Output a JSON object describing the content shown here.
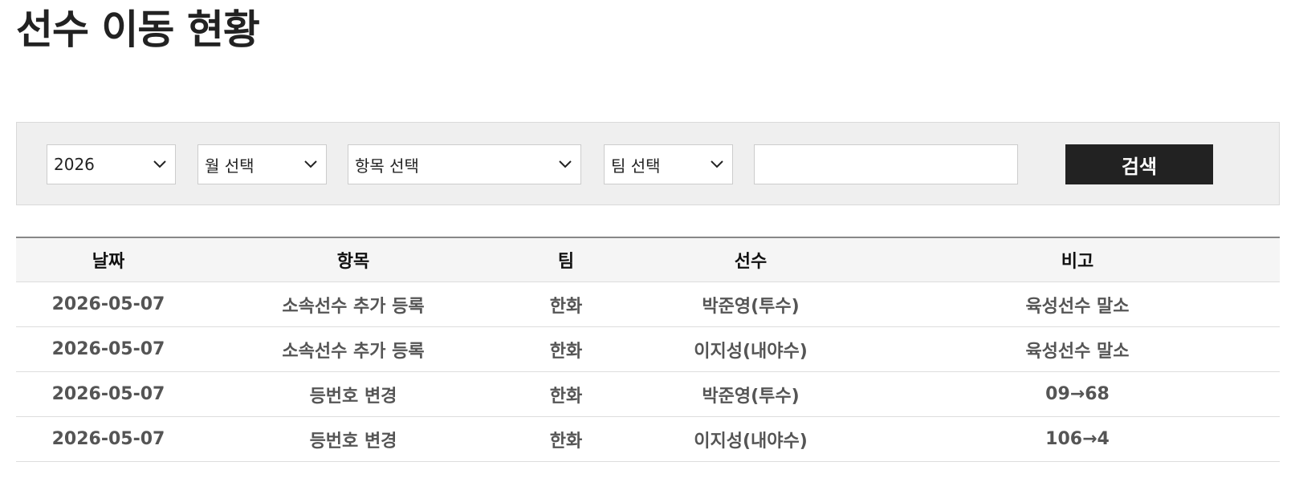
{
  "page": {
    "title": "선수 이동 현황"
  },
  "filters": {
    "year": {
      "selected": "2026"
    },
    "month": {
      "selected": "월 선택"
    },
    "item": {
      "selected": "항목 선택"
    },
    "team": {
      "selected": "팀 선택"
    },
    "search_input": {
      "value": "",
      "placeholder": ""
    },
    "search_button_label": "검색"
  },
  "icons": {
    "dropdown": "chevron-down-icon"
  },
  "table": {
    "headers": [
      "날짜",
      "항목",
      "팀",
      "선수",
      "비고"
    ],
    "rows": [
      [
        "2026-05-07",
        "소속선수 추가 등록",
        "한화",
        "박준영(투수)",
        "육성선수 말소"
      ],
      [
        "2026-05-07",
        "소속선수 추가 등록",
        "한화",
        "이지성(내야수)",
        "육성선수 말소"
      ],
      [
        "2026-05-07",
        "등번호 변경",
        "한화",
        "박준영(투수)",
        "09→68"
      ],
      [
        "2026-05-07",
        "등번호 변경",
        "한화",
        "이지성(내야수)",
        "106→4"
      ]
    ]
  },
  "colors": {
    "panel_background": "#efefef",
    "button_background": "#222222",
    "header_background": "#f5f5f5",
    "row_text": "#555555"
  }
}
